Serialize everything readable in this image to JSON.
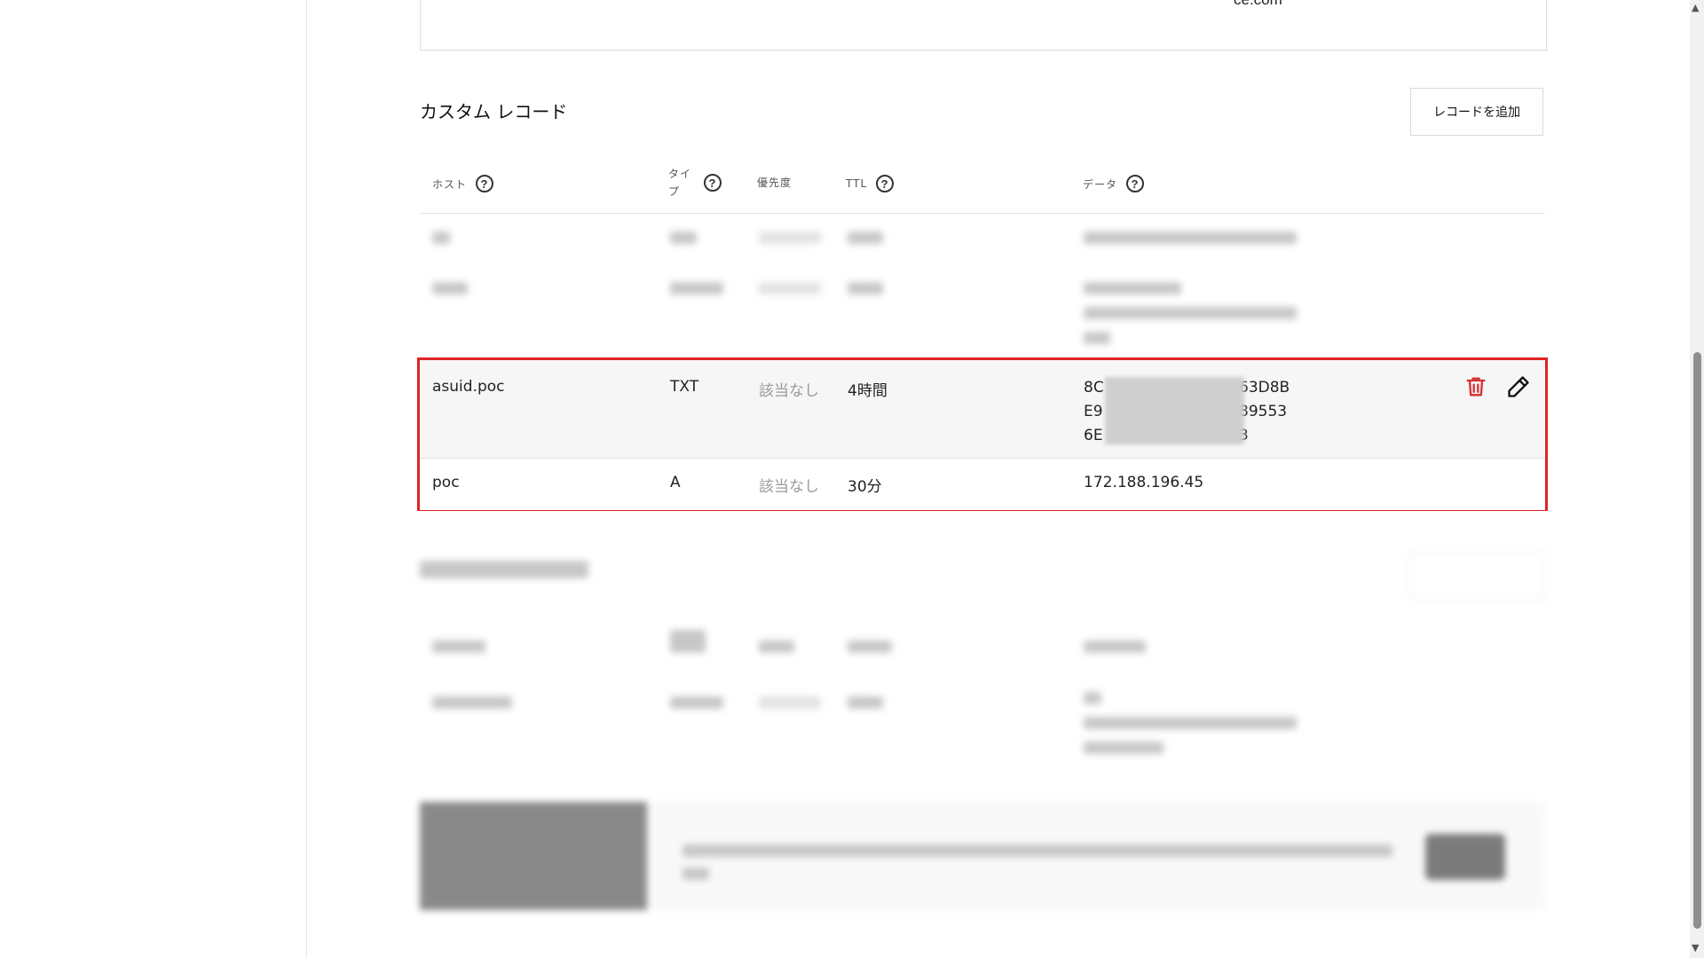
{
  "top_card": {
    "text": "ce.com"
  },
  "section": {
    "title": "カスタム レコード",
    "add_button": "レコードを追加"
  },
  "table": {
    "headers": {
      "host": "ホスト",
      "type": "タイプ",
      "priority": "優先度",
      "ttl": "TTL",
      "data": "データ"
    },
    "help_glyph": "?"
  },
  "records": [
    {
      "host": "asuid.poc",
      "type": "TXT",
      "priority": "該当なし",
      "ttl": "4時間",
      "data_lines": [
        "8C",
        "E9",
        "6E"
      ],
      "data_tail": [
        "63D8B",
        "89553",
        "3"
      ]
    },
    {
      "host": "poc",
      "type": "A",
      "priority": "該当なし",
      "ttl": "30分",
      "data": "172.188.196.45"
    }
  ],
  "colors": {
    "accent_border": "#e02424",
    "delete_icon": "#d63131"
  },
  "icons": {
    "delete": "trash-icon",
    "edit": "pencil-icon"
  }
}
